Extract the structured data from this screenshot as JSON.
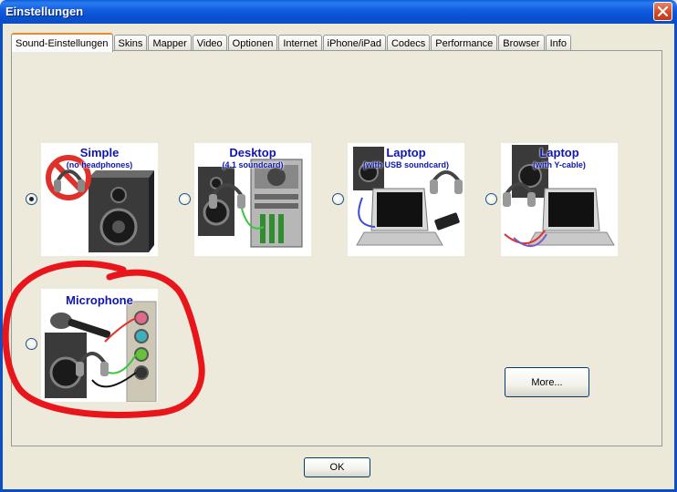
{
  "window": {
    "title": "Einstellungen"
  },
  "tabs": [
    {
      "label": "Sound-Einstellungen",
      "active": true
    },
    {
      "label": "Skins"
    },
    {
      "label": "Mapper"
    },
    {
      "label": "Video"
    },
    {
      "label": "Optionen"
    },
    {
      "label": "Internet"
    },
    {
      "label": "iPhone/iPad"
    },
    {
      "label": "Codecs"
    },
    {
      "label": "Performance"
    },
    {
      "label": "Browser"
    },
    {
      "label": "Info"
    }
  ],
  "options": [
    {
      "title": "Simple",
      "subtitle": "(no headphones)",
      "selected": true
    },
    {
      "title": "Desktop",
      "subtitle": "(4.1 soundcard)",
      "selected": false
    },
    {
      "title": "Laptop",
      "subtitle": "(with USB soundcard)",
      "selected": false
    },
    {
      "title": "Laptop",
      "subtitle": "(with Y-cable)",
      "selected": false
    },
    {
      "title": "Microphone",
      "subtitle": "",
      "selected": false
    }
  ],
  "buttons": {
    "more": "More...",
    "ok": "OK"
  },
  "colors": {
    "accent_text": "#0F16B0",
    "annotation": "#E8161A",
    "titlebar": "#0B4FC4"
  }
}
